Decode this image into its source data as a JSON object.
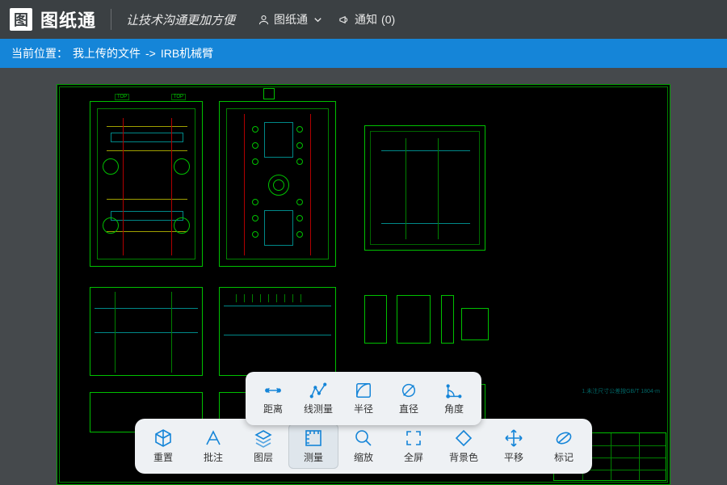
{
  "header": {
    "logo_glyph": "图",
    "logo_text": "图纸通",
    "tagline": "让技术沟通更加方便",
    "user_label": "图纸通",
    "notify_label": "通知",
    "notify_count": "(0)"
  },
  "breadcrumb": {
    "prefix": "当前位置：",
    "path1": "我上传的文件",
    "sep": "->",
    "path2": "IRB机械臂"
  },
  "cad": {
    "top_label": "TOP",
    "note": "1.未注尺寸公差按GB/T 1804-m"
  },
  "submenu": {
    "items": [
      {
        "id": "distance",
        "label": "距离"
      },
      {
        "id": "polyline",
        "label": "线测量"
      },
      {
        "id": "radius",
        "label": "半径"
      },
      {
        "id": "diameter",
        "label": "直径"
      },
      {
        "id": "angle",
        "label": "角度"
      }
    ]
  },
  "toolbar": {
    "items": [
      {
        "id": "reset",
        "label": "重置"
      },
      {
        "id": "annotate",
        "label": "批注"
      },
      {
        "id": "layers",
        "label": "图层"
      },
      {
        "id": "measure",
        "label": "测量",
        "active": true
      },
      {
        "id": "zoom",
        "label": "缩放"
      },
      {
        "id": "fullscreen",
        "label": "全屏"
      },
      {
        "id": "bgcolor",
        "label": "背景色"
      },
      {
        "id": "pan",
        "label": "平移"
      },
      {
        "id": "mark",
        "label": "标记"
      }
    ]
  }
}
